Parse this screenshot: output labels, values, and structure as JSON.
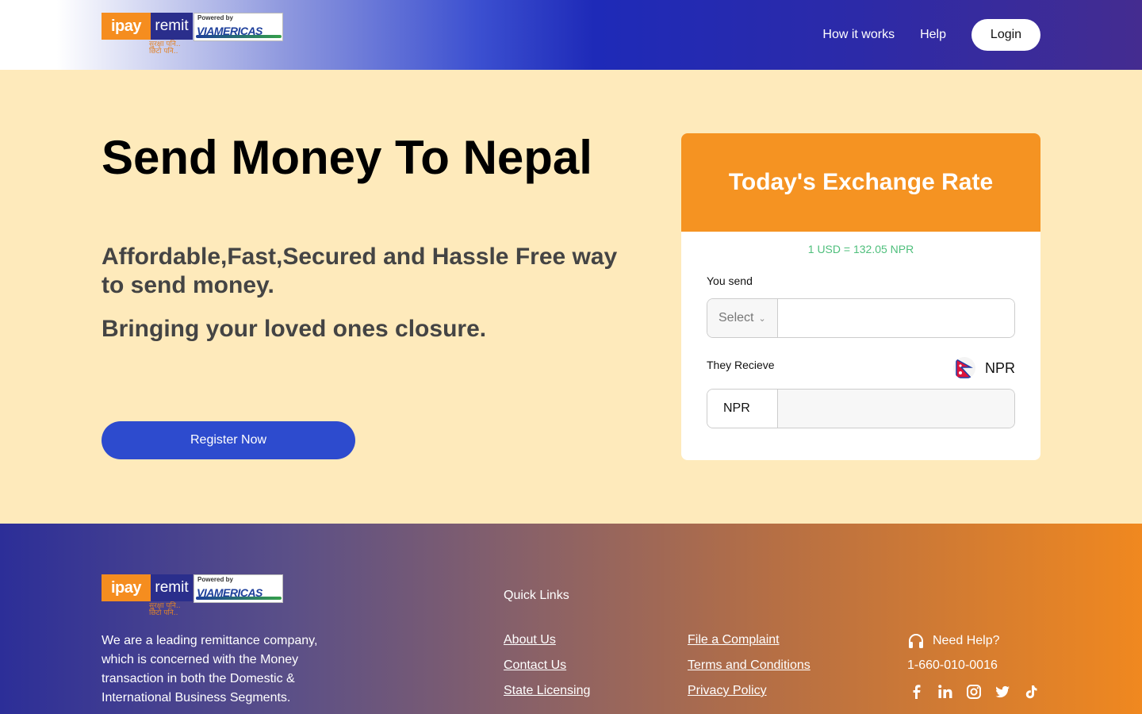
{
  "brand": {
    "logo_ipay": "ipay",
    "logo_remit": "remit",
    "logo_tagline": "सुरक्षा पनि.. छिटो पनि..",
    "powered_by": "Powered by",
    "partner": "VIAMERICAS"
  },
  "nav": {
    "how_it_works": "How it works",
    "help": "Help",
    "login": "Login"
  },
  "hero": {
    "title": "Send Money To Nepal",
    "subtitle": "Affordable,Fast,Secured and Hassle Free way to send money.",
    "subtitle2": "Bringing your loved ones closure.",
    "register": "Register Now"
  },
  "exchange": {
    "title": "Today's Exchange Rate",
    "rate": "1 USD = 132.05 NPR",
    "you_send_label": "You send",
    "select_placeholder": "Select",
    "send_amount": "",
    "they_receive_label": "They Recieve",
    "receive_currency": "NPR",
    "receive_prefix": "NPR",
    "receive_amount": ""
  },
  "footer": {
    "about": "We are a leading remittance company, which is concerned with the Money transaction in both the Domestic & International Business Segments.",
    "quick_links_title": "Quick Links",
    "links_col1": [
      "About Us",
      "Contact Us",
      "State Licensing"
    ],
    "links_col2": [
      "File a Complaint",
      "Terms and Conditions",
      "Privacy Policy"
    ],
    "need_help": "Need Help?",
    "phone": "1-660-010-0016",
    "socials": [
      "facebook-icon",
      "linkedin-icon",
      "instagram-icon",
      "twitter-icon",
      "tiktok-icon"
    ]
  },
  "colors": {
    "accent_orange": "#f59322",
    "primary_blue": "#2d4bce",
    "hero_bg": "#feeabb",
    "rate_green": "#4fbf7c"
  }
}
